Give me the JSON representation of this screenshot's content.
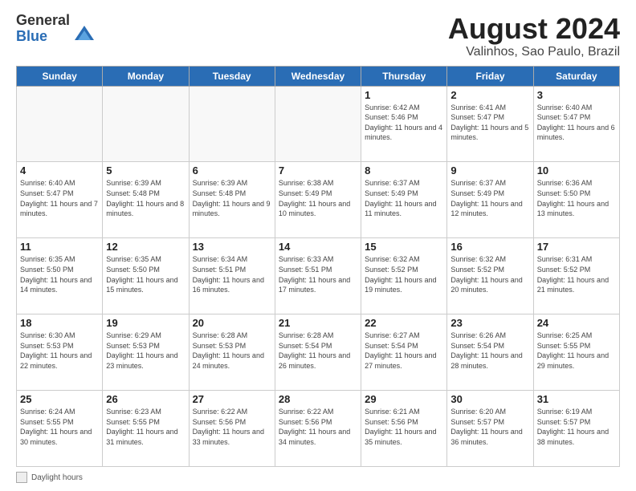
{
  "logo": {
    "general": "General",
    "blue": "Blue"
  },
  "title": {
    "month": "August 2024",
    "location": "Valinhos, Sao Paulo, Brazil"
  },
  "headers": [
    "Sunday",
    "Monday",
    "Tuesday",
    "Wednesday",
    "Thursday",
    "Friday",
    "Saturday"
  ],
  "weeks": [
    [
      {
        "day": "",
        "info": ""
      },
      {
        "day": "",
        "info": ""
      },
      {
        "day": "",
        "info": ""
      },
      {
        "day": "",
        "info": ""
      },
      {
        "day": "1",
        "info": "Sunrise: 6:42 AM\nSunset: 5:46 PM\nDaylight: 11 hours\nand 4 minutes."
      },
      {
        "day": "2",
        "info": "Sunrise: 6:41 AM\nSunset: 5:47 PM\nDaylight: 11 hours\nand 5 minutes."
      },
      {
        "day": "3",
        "info": "Sunrise: 6:40 AM\nSunset: 5:47 PM\nDaylight: 11 hours\nand 6 minutes."
      }
    ],
    [
      {
        "day": "4",
        "info": "Sunrise: 6:40 AM\nSunset: 5:47 PM\nDaylight: 11 hours\nand 7 minutes."
      },
      {
        "day": "5",
        "info": "Sunrise: 6:39 AM\nSunset: 5:48 PM\nDaylight: 11 hours\nand 8 minutes."
      },
      {
        "day": "6",
        "info": "Sunrise: 6:39 AM\nSunset: 5:48 PM\nDaylight: 11 hours\nand 9 minutes."
      },
      {
        "day": "7",
        "info": "Sunrise: 6:38 AM\nSunset: 5:49 PM\nDaylight: 11 hours\nand 10 minutes."
      },
      {
        "day": "8",
        "info": "Sunrise: 6:37 AM\nSunset: 5:49 PM\nDaylight: 11 hours\nand 11 minutes."
      },
      {
        "day": "9",
        "info": "Sunrise: 6:37 AM\nSunset: 5:49 PM\nDaylight: 11 hours\nand 12 minutes."
      },
      {
        "day": "10",
        "info": "Sunrise: 6:36 AM\nSunset: 5:50 PM\nDaylight: 11 hours\nand 13 minutes."
      }
    ],
    [
      {
        "day": "11",
        "info": "Sunrise: 6:35 AM\nSunset: 5:50 PM\nDaylight: 11 hours\nand 14 minutes."
      },
      {
        "day": "12",
        "info": "Sunrise: 6:35 AM\nSunset: 5:50 PM\nDaylight: 11 hours\nand 15 minutes."
      },
      {
        "day": "13",
        "info": "Sunrise: 6:34 AM\nSunset: 5:51 PM\nDaylight: 11 hours\nand 16 minutes."
      },
      {
        "day": "14",
        "info": "Sunrise: 6:33 AM\nSunset: 5:51 PM\nDaylight: 11 hours\nand 17 minutes."
      },
      {
        "day": "15",
        "info": "Sunrise: 6:32 AM\nSunset: 5:52 PM\nDaylight: 11 hours\nand 19 minutes."
      },
      {
        "day": "16",
        "info": "Sunrise: 6:32 AM\nSunset: 5:52 PM\nDaylight: 11 hours\nand 20 minutes."
      },
      {
        "day": "17",
        "info": "Sunrise: 6:31 AM\nSunset: 5:52 PM\nDaylight: 11 hours\nand 21 minutes."
      }
    ],
    [
      {
        "day": "18",
        "info": "Sunrise: 6:30 AM\nSunset: 5:53 PM\nDaylight: 11 hours\nand 22 minutes."
      },
      {
        "day": "19",
        "info": "Sunrise: 6:29 AM\nSunset: 5:53 PM\nDaylight: 11 hours\nand 23 minutes."
      },
      {
        "day": "20",
        "info": "Sunrise: 6:28 AM\nSunset: 5:53 PM\nDaylight: 11 hours\nand 24 minutes."
      },
      {
        "day": "21",
        "info": "Sunrise: 6:28 AM\nSunset: 5:54 PM\nDaylight: 11 hours\nand 26 minutes."
      },
      {
        "day": "22",
        "info": "Sunrise: 6:27 AM\nSunset: 5:54 PM\nDaylight: 11 hours\nand 27 minutes."
      },
      {
        "day": "23",
        "info": "Sunrise: 6:26 AM\nSunset: 5:54 PM\nDaylight: 11 hours\nand 28 minutes."
      },
      {
        "day": "24",
        "info": "Sunrise: 6:25 AM\nSunset: 5:55 PM\nDaylight: 11 hours\nand 29 minutes."
      }
    ],
    [
      {
        "day": "25",
        "info": "Sunrise: 6:24 AM\nSunset: 5:55 PM\nDaylight: 11 hours\nand 30 minutes."
      },
      {
        "day": "26",
        "info": "Sunrise: 6:23 AM\nSunset: 5:55 PM\nDaylight: 11 hours\nand 31 minutes."
      },
      {
        "day": "27",
        "info": "Sunrise: 6:22 AM\nSunset: 5:56 PM\nDaylight: 11 hours\nand 33 minutes."
      },
      {
        "day": "28",
        "info": "Sunrise: 6:22 AM\nSunset: 5:56 PM\nDaylight: 11 hours\nand 34 minutes."
      },
      {
        "day": "29",
        "info": "Sunrise: 6:21 AM\nSunset: 5:56 PM\nDaylight: 11 hours\nand 35 minutes."
      },
      {
        "day": "30",
        "info": "Sunrise: 6:20 AM\nSunset: 5:57 PM\nDaylight: 11 hours\nand 36 minutes."
      },
      {
        "day": "31",
        "info": "Sunrise: 6:19 AM\nSunset: 5:57 PM\nDaylight: 11 hours\nand 38 minutes."
      }
    ]
  ],
  "footer": {
    "daylight_label": "Daylight hours"
  }
}
